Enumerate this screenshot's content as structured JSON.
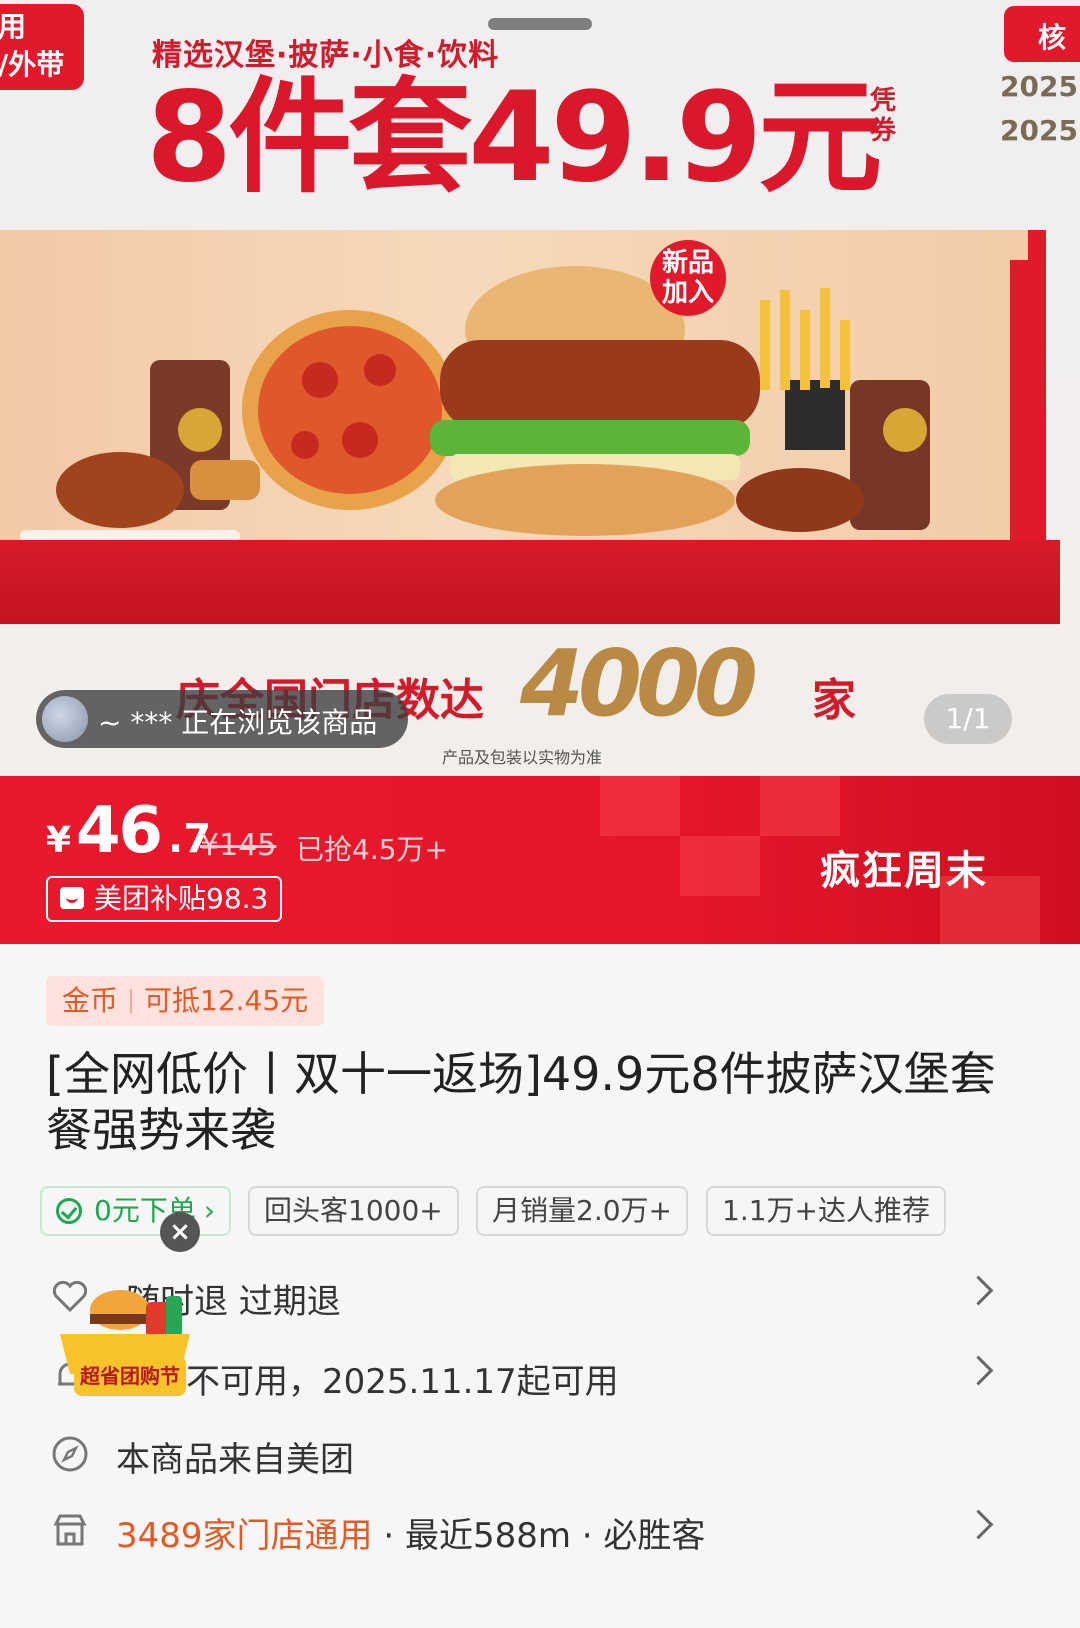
{
  "banner": {
    "corner_left_line1": "用",
    "corner_left_line2": "/外带",
    "corner_right": "核",
    "date1": "2025",
    "date2": "2025",
    "subtitle": "精选汉堡·披萨·小食·饮料",
    "title": "8件套49.9元",
    "title_tag": "凭券",
    "new_badge": "新品加入",
    "store_text": "庆全国门店数达",
    "store_count": "4000",
    "store_unit": "家",
    "package_note": "产品及包装以实物为准",
    "viewer_text": "~ *** 正在浏览该商品",
    "image_counter": "1/1"
  },
  "price": {
    "currency": "¥",
    "integer": "46",
    "decimal": ".7",
    "original": "¥145",
    "sold": "已抢4.5万+",
    "subsidy": "美团补贴98.3",
    "promo": "疯狂周末"
  },
  "coin": {
    "label": "金币",
    "value": "可抵12.45元"
  },
  "deal_title": "[全网低价丨双十一返场]49.9元8件披萨汉堡套餐强势来袭",
  "tags": [
    "0元下单",
    "回头客1000+",
    "月销量2.0万+",
    "1.1万+达人推荐"
  ],
  "rows": {
    "refund": "随时退  过期退",
    "availability": "不可用，2025.11.17起可用",
    "source": "本商品来自美团",
    "stores_count": "3489家门店通用",
    "stores_rest": " · 最近588m · 必胜客"
  },
  "festival_label": "超省团购节",
  "colors": {
    "brand_red": "#e5162a",
    "accent_orange": "#e55a24",
    "green": "#1fa84f"
  }
}
